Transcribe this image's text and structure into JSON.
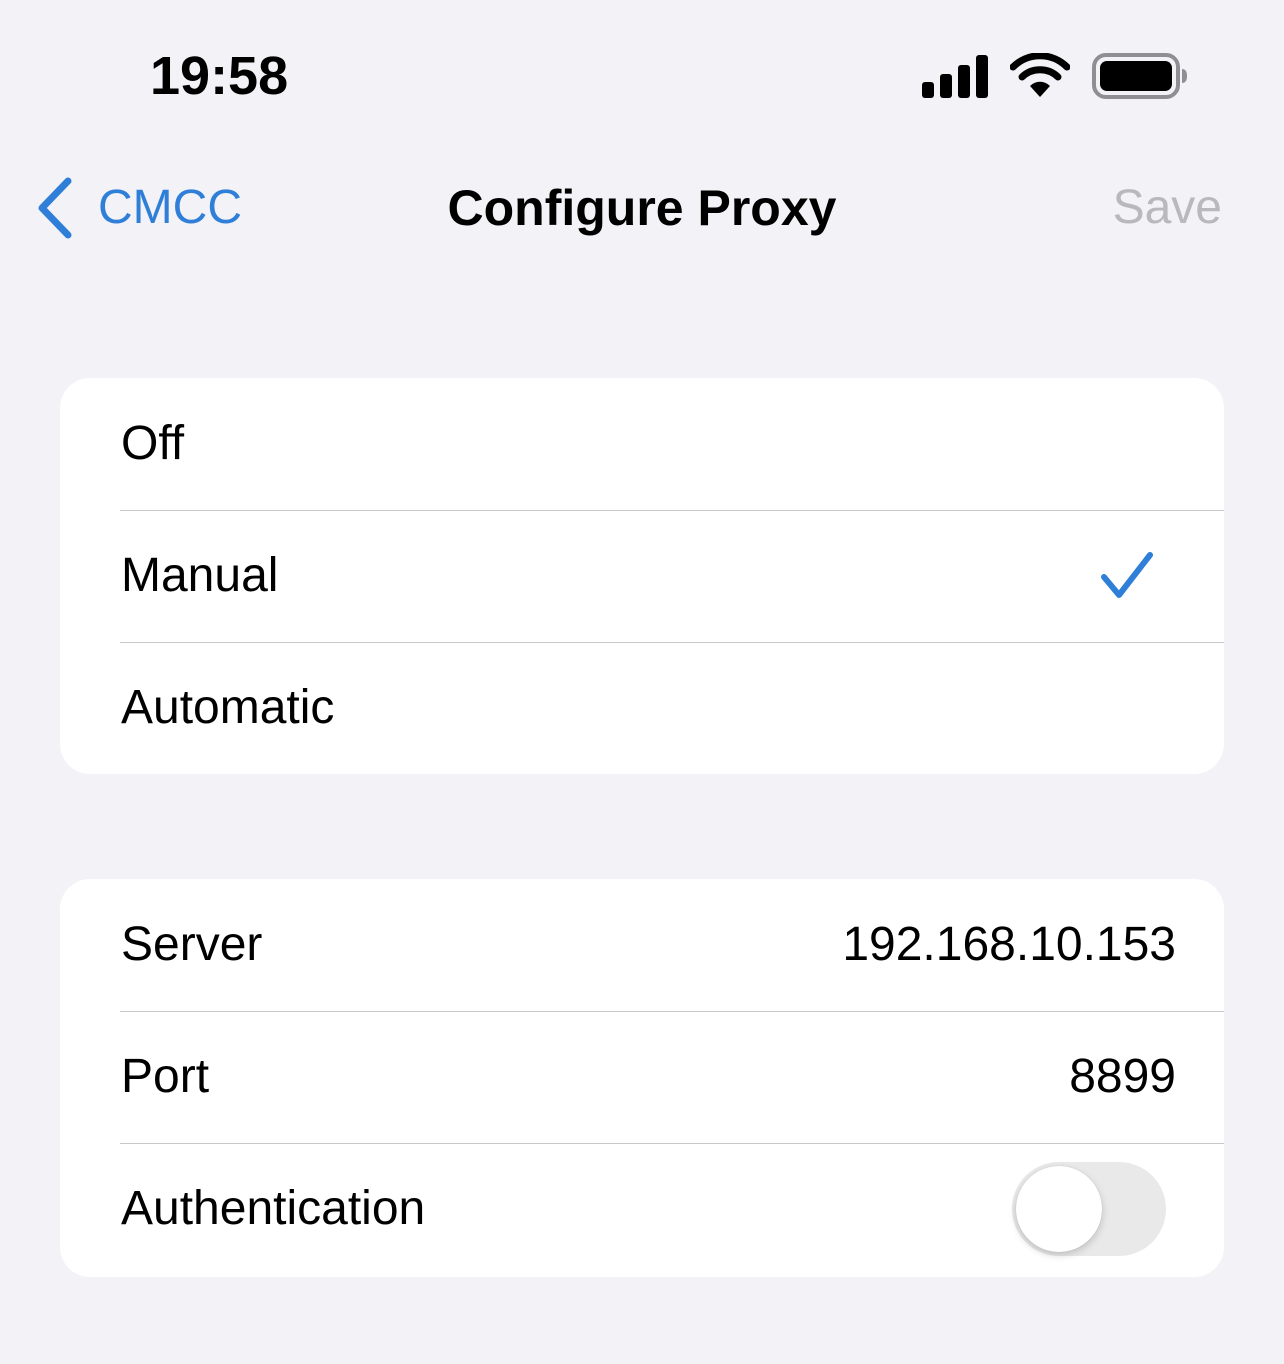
{
  "status_bar": {
    "time": "19:58",
    "icons": [
      "cellular-signal-icon",
      "wifi-icon",
      "battery-icon"
    ]
  },
  "nav": {
    "back_label": "CMCC",
    "title": "Configure Proxy",
    "save_label": "Save"
  },
  "proxy_mode": {
    "options": [
      {
        "label": "Off",
        "selected": false
      },
      {
        "label": "Manual",
        "selected": true
      },
      {
        "label": "Automatic",
        "selected": false
      }
    ]
  },
  "manual_settings": {
    "server_label": "Server",
    "server_value": "192.168.10.153",
    "port_label": "Port",
    "port_value": "8899",
    "authentication_label": "Authentication",
    "authentication_enabled": false
  },
  "colors": {
    "background": "#f2f2f7",
    "accent": "#2f7fd8",
    "disabled_text": "#b8b8bd",
    "toggle_off": "#e9e9ea"
  }
}
